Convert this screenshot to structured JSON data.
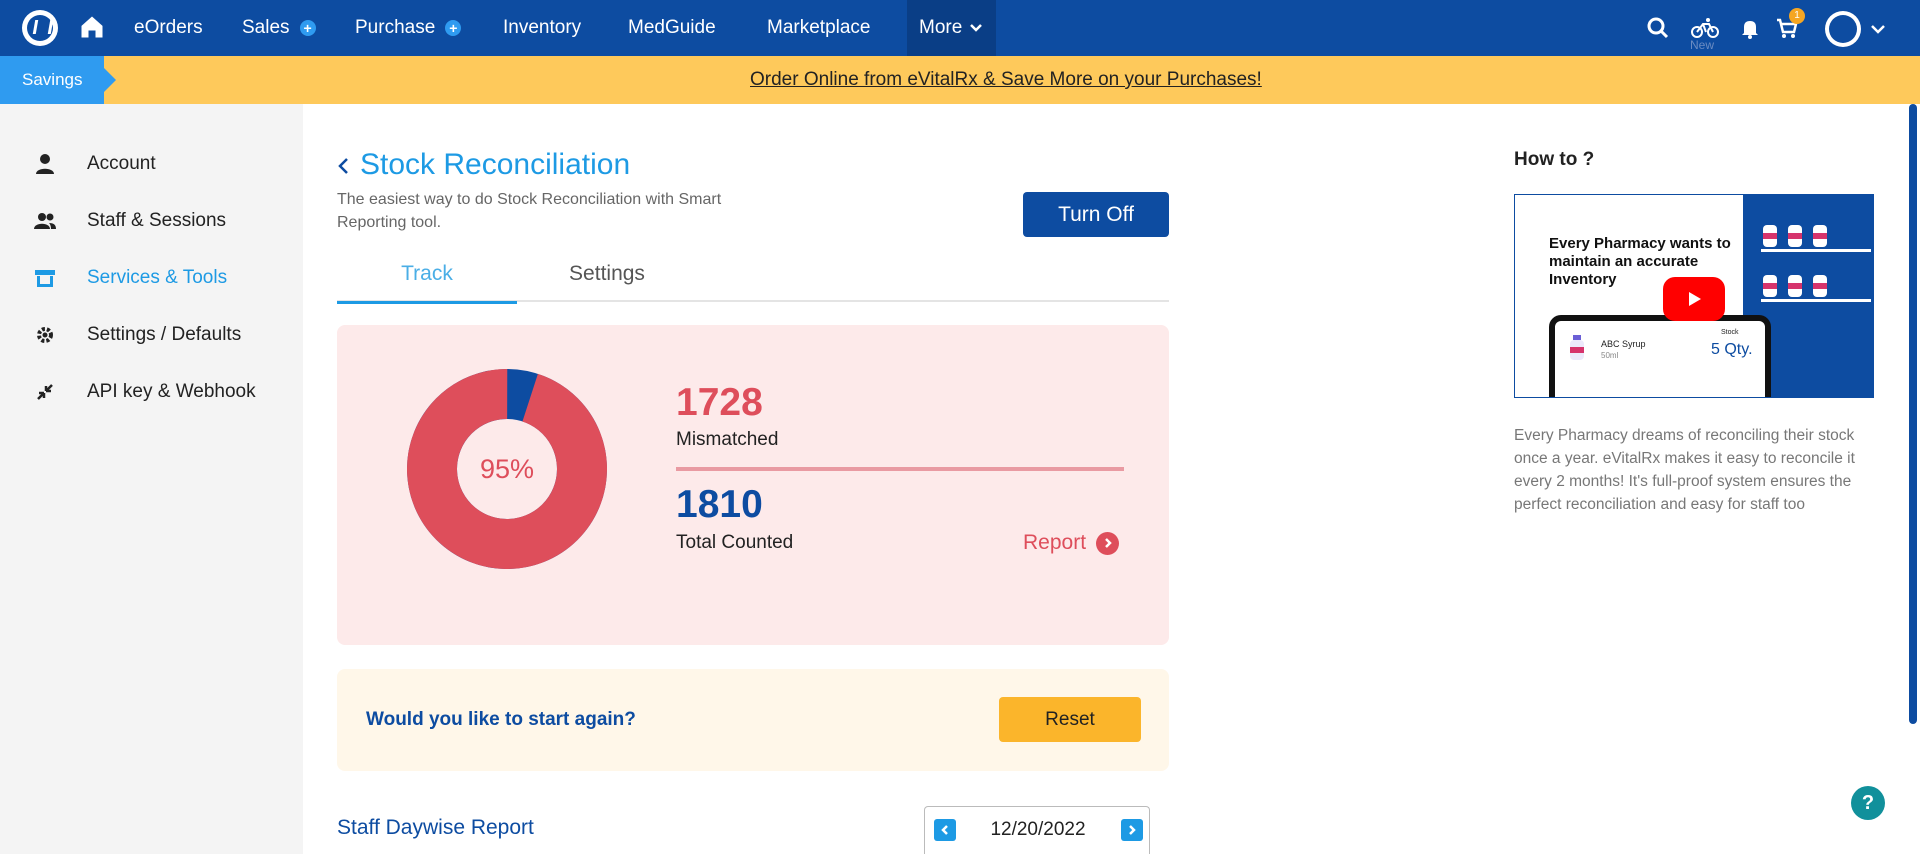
{
  "nav": {
    "items": [
      {
        "label": "eOrders"
      },
      {
        "label": "Sales"
      },
      {
        "label": "Purchase"
      },
      {
        "label": "Inventory"
      },
      {
        "label": "MedGuide"
      },
      {
        "label": "Marketplace"
      },
      {
        "label": "More"
      }
    ],
    "new_tag": "New",
    "cart_count": "1"
  },
  "banner": {
    "tag": "Savings",
    "text": "Order Online from eVitalRx & Save More on your Purchases!"
  },
  "sidebar": {
    "items": [
      {
        "label": "Account",
        "icon": "person-icon"
      },
      {
        "label": "Staff & Sessions",
        "icon": "people-icon"
      },
      {
        "label": "Services & Tools",
        "icon": "store-icon",
        "active": true
      },
      {
        "label": "Settings / Defaults",
        "icon": "gear-icon"
      },
      {
        "label": "API key & Webhook",
        "icon": "compress-icon"
      }
    ]
  },
  "main": {
    "title": "Stock Reconciliation",
    "subtitle": "The easiest way to do Stock Reconciliation with Smart Reporting tool.",
    "turn_off_label": "Turn Off",
    "tabs": [
      {
        "label": "Track",
        "active": true
      },
      {
        "label": "Settings"
      }
    ],
    "stats": {
      "percent_label": "95%",
      "mismatched_fraction": 0.95,
      "mismatched_value": "1728",
      "mismatched_label": "Mismatched",
      "total_value": "1810",
      "total_label": "Total Counted",
      "report_label": "Report"
    },
    "reset": {
      "question": "Would you like to start again?",
      "button_label": "Reset"
    },
    "daywise": {
      "title": "Staff Daywise Report",
      "date": "12/20/2022"
    }
  },
  "howto": {
    "title": "How to ?",
    "video": {
      "headline": "Every Pharmacy wants to maintain an accurate Inventory",
      "product": "ABC Syrup",
      "product_size": "50ml",
      "stock_label": "Stock",
      "qty_label": "Qty.",
      "qty_value": "5"
    },
    "description": "Every Pharmacy dreams of reconciling their stock once a year. eVitalRx makes it easy to reconcile it every 2 months! It's full-proof system ensures the perfect reconciliation and easy for staff too"
  },
  "help_label": "?",
  "colors": {
    "brand_blue": "#0d4ca1",
    "accent_blue": "#1d9ae4",
    "mismatch_red": "#de4e5b",
    "banner_yellow": "#fec95b",
    "reset_yellow": "#fbb52b"
  }
}
